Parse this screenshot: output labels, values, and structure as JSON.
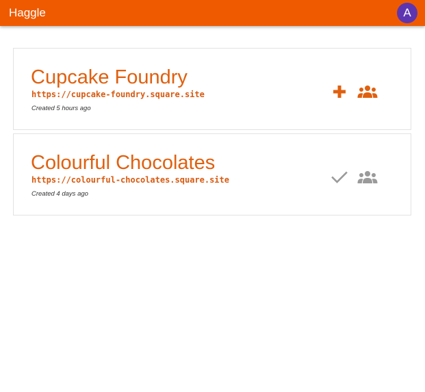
{
  "app": {
    "title": "Haggle",
    "avatar_initial": "A",
    "accent_color": "#ef5a00",
    "avatar_color": "#5e35b1"
  },
  "shops": [
    {
      "name": "Cupcake Foundry",
      "url": "https://cupcake-foundry.square.site",
      "created": "Created 5 hours ago",
      "primary_action_icon": "plus-icon",
      "secondary_action_icon": "group-icon",
      "state": "not-joined"
    },
    {
      "name": "Colourful Chocolates",
      "url": "https://colourful-chocolates.square.site",
      "created": "Created 4 days ago",
      "primary_action_icon": "check-icon",
      "secondary_action_icon": "group-icon",
      "state": "joined"
    }
  ]
}
